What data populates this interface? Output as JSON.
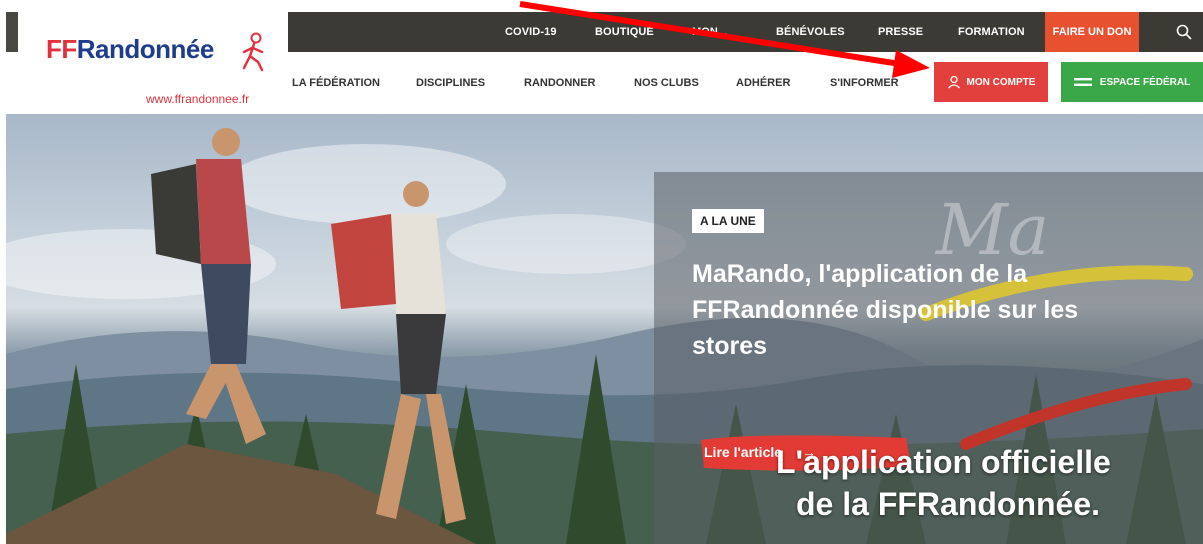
{
  "top_bar": {
    "links": [
      "COVID-19",
      "BOUTIQUE",
      "MON...",
      "BÉNÉVOLES",
      "PRESSE",
      "FORMATION"
    ],
    "donate": "FAIRE UN DON"
  },
  "logo": {
    "ff": "FF",
    "rest": "Randonnée",
    "url": "www.ffrandonnee.fr"
  },
  "nav": {
    "items": [
      "LA FÉDÉRATION",
      "DISCIPLINES",
      "RANDONNER",
      "NOS CLUBS",
      "ADHÉRER",
      "S'INFORMER"
    ],
    "account": "MON COMPTE",
    "federal": "ESPACE FÉDÉRAL"
  },
  "hero": {
    "badge": "A LA UNE",
    "headline": "MaRando, l'application de la FFRandonnée disponible sur les stores",
    "cta": "Lire l'article",
    "cta_arrow": "→",
    "app_line1": "L'application officielle",
    "app_line2": "de la FFRandonnée."
  },
  "colors": {
    "brand_blue": "#1f3c8a",
    "brand_red": "#e2313c",
    "donate": "#e8512f",
    "account": "#e2403c",
    "federal": "#3aa748",
    "annotation_arrow": "#ff0000"
  }
}
